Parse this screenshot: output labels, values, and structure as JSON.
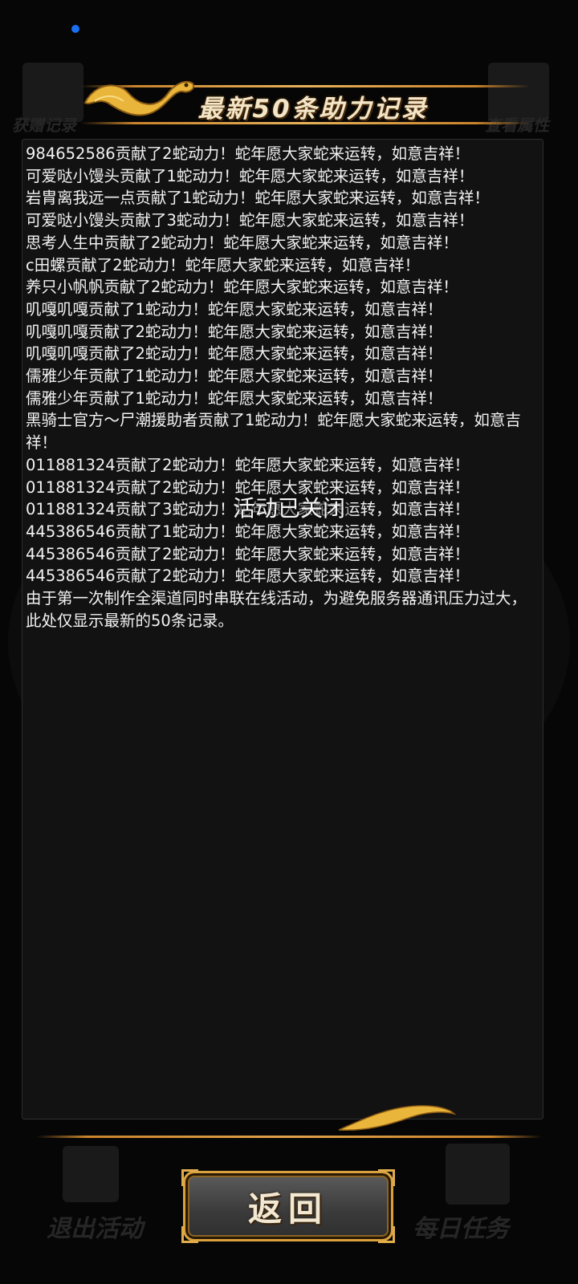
{
  "title": "最新50条助力记录",
  "background": {
    "top_left_label": "获赠记录",
    "top_right_label": "查看属性",
    "bottom_left_label": "退出活动",
    "bottom_right_label": "每日任务"
  },
  "records": [
    "984652586贡献了2蛇动力！蛇年愿大家蛇来运转，如意吉祥！",
    "可爱哒小馒头贡献了1蛇动力！蛇年愿大家蛇来运转，如意吉祥！",
    "岩胄离我远一点贡献了1蛇动力！蛇年愿大家蛇来运转，如意吉祥！",
    "可爱哒小馒头贡献了3蛇动力！蛇年愿大家蛇来运转，如意吉祥！",
    "思考人生中贡献了2蛇动力！蛇年愿大家蛇来运转，如意吉祥！",
    "c田螺贡献了2蛇动力！蛇年愿大家蛇来运转，如意吉祥！",
    "养只小帆帆贡献了2蛇动力！蛇年愿大家蛇来运转，如意吉祥！",
    "叽嘎叽嘎贡献了1蛇动力！蛇年愿大家蛇来运转，如意吉祥！",
    "叽嘎叽嘎贡献了2蛇动力！蛇年愿大家蛇来运转，如意吉祥！",
    "叽嘎叽嘎贡献了2蛇动力！蛇年愿大家蛇来运转，如意吉祥！",
    "儒雅少年贡献了1蛇动力！蛇年愿大家蛇来运转，如意吉祥！",
    "儒雅少年贡献了1蛇动力！蛇年愿大家蛇来运转，如意吉祥！",
    "黑骑士官方～尸潮援助者贡献了1蛇动力！蛇年愿大家蛇来运转，如意吉祥！",
    "011881324贡献了2蛇动力！蛇年愿大家蛇来运转，如意吉祥！",
    "011881324贡献了2蛇动力！蛇年愿大家蛇来运转，如意吉祥！",
    "011881324贡献了3蛇动力！蛇年愿大家蛇来运转，如意吉祥！",
    "445386546贡献了1蛇动力！蛇年愿大家蛇来运转，如意吉祥！",
    "445386546贡献了2蛇动力！蛇年愿大家蛇来运转，如意吉祥！",
    "445386546贡献了2蛇动力！蛇年愿大家蛇来运转，如意吉祥！",
    "由于第一次制作全渠道同时串联在线活动，为避免服务器通讯压力过大，此处仅显示最新的50条记录。"
  ],
  "toast": "活动已关闭",
  "back_button": "返回",
  "colors": {
    "gold": "#d9a23f",
    "panel": "#121212",
    "text": "#f2f2f2",
    "status_dot": "#1a6ff0"
  }
}
